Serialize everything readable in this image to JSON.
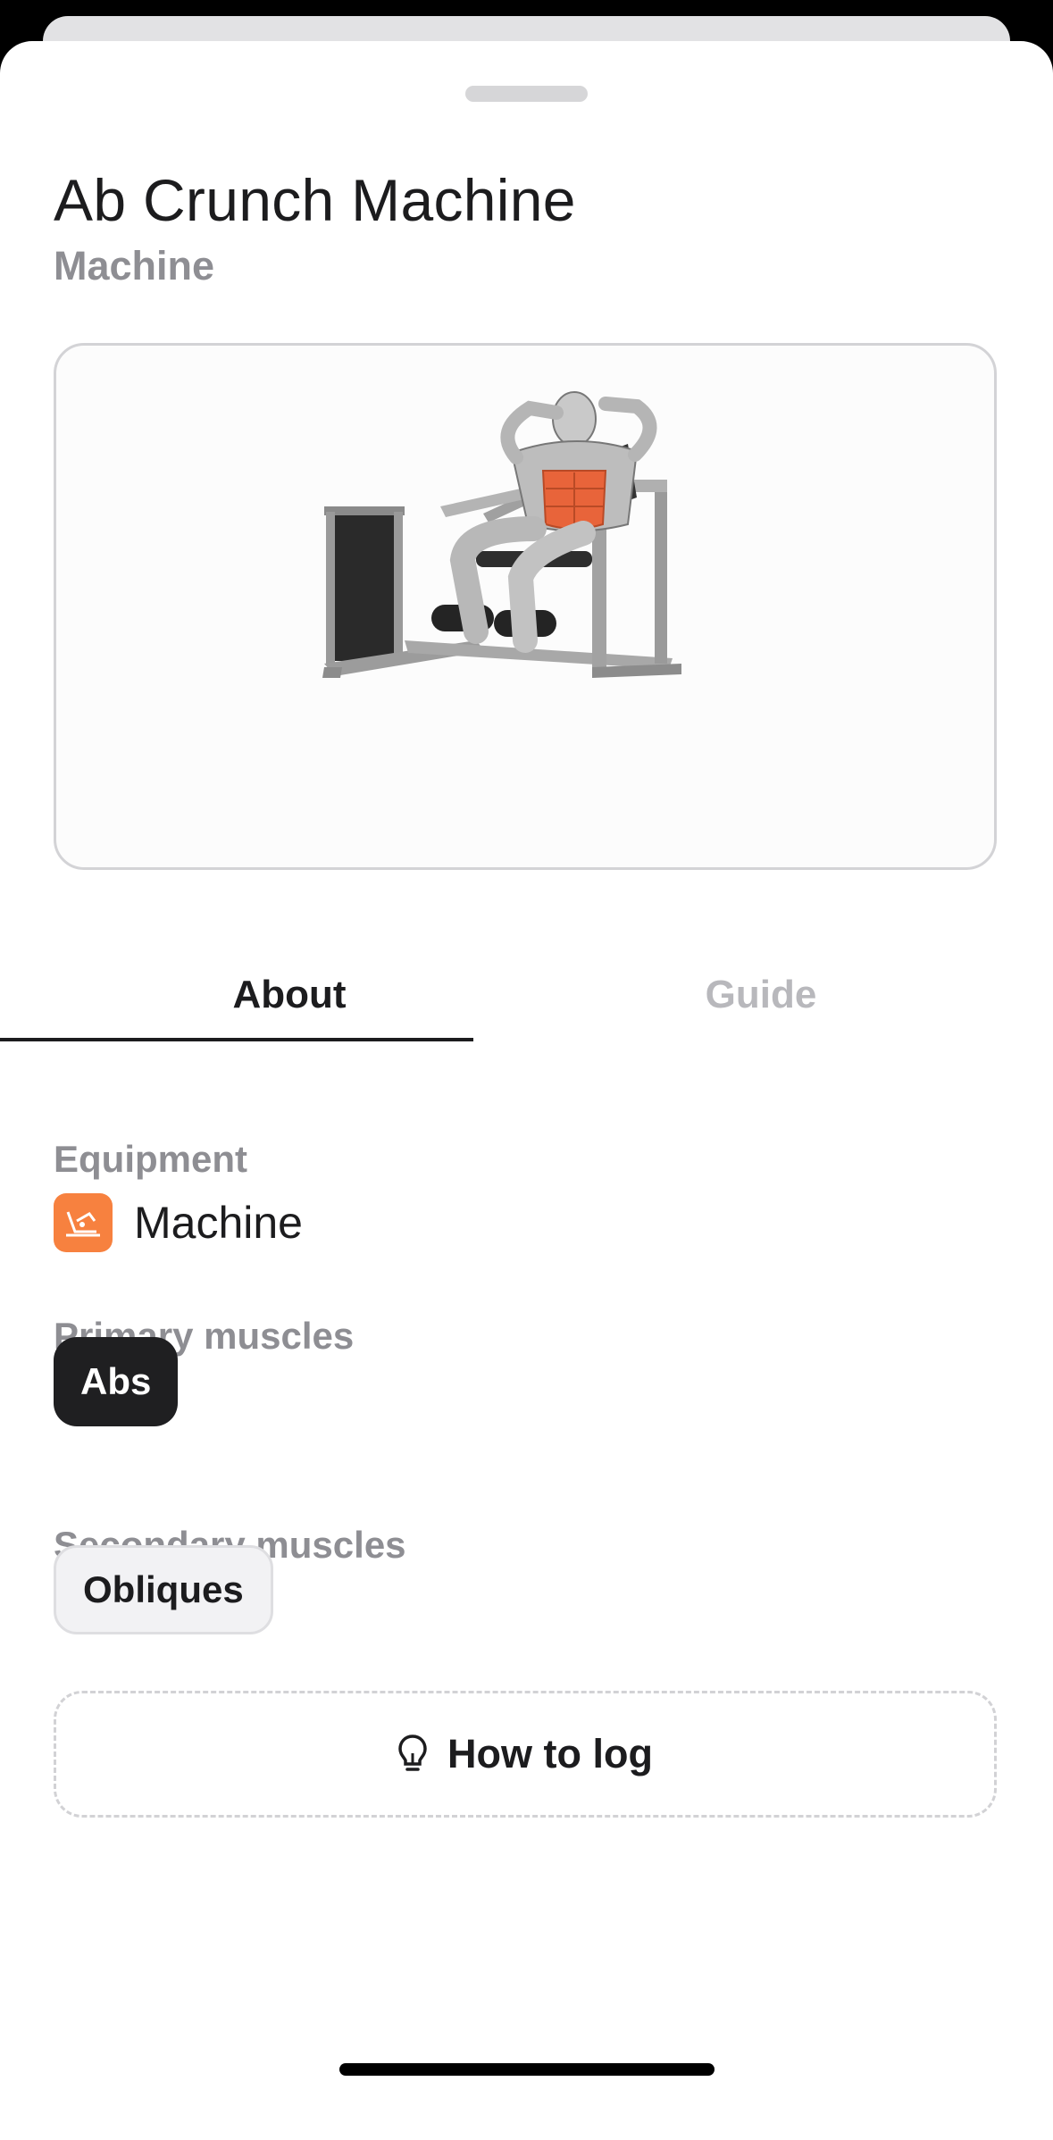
{
  "exercise": {
    "title": "Ab Crunch Machine",
    "subtitle": "Machine"
  },
  "tabs": [
    {
      "label": "About",
      "active": true
    },
    {
      "label": "Guide",
      "active": false
    }
  ],
  "about": {
    "equipment_heading": "Equipment",
    "equipment": {
      "label": "Machine",
      "icon": "machine-icon",
      "icon_color": "#f7813f"
    },
    "primary_heading": "Primary muscles",
    "primary_muscles": [
      "Abs"
    ],
    "secondary_heading": "Secondary muscles",
    "secondary_muscles": [
      "Obliques"
    ]
  },
  "how_to_log": {
    "label": "How to log",
    "icon": "lightbulb-icon"
  },
  "image": {
    "highlight_color": "#e8643a",
    "subject": "exercise-illustration"
  }
}
